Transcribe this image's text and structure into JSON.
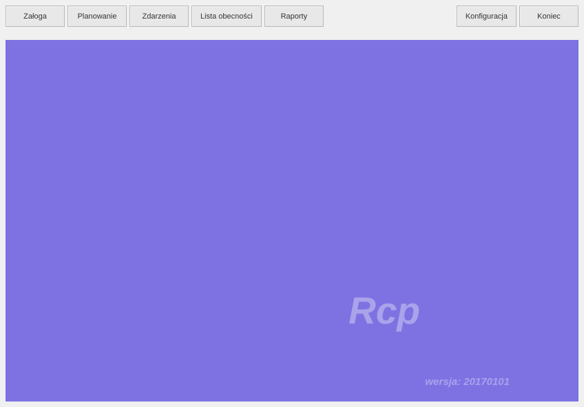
{
  "toolbar": {
    "left": [
      {
        "label": "Załoga"
      },
      {
        "label": "Planowanie"
      },
      {
        "label": "Zdarzenia"
      },
      {
        "label": "Lista obecności"
      },
      {
        "label": "Raporty"
      }
    ],
    "right": [
      {
        "label": "Konfiguracja"
      },
      {
        "label": "Koniec"
      }
    ]
  },
  "main": {
    "app_title": "Rcp",
    "version_label": "wersja: 20170101"
  }
}
